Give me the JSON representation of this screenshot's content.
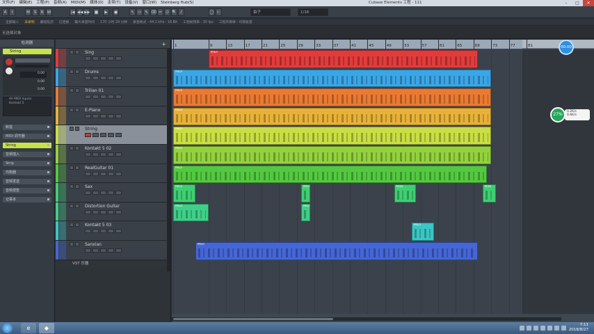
{
  "menu": [
    "文件(F)",
    "编辑(E)",
    "工程(P)",
    "音频(A)",
    "MIDI(M)",
    "媒体(D)",
    "走带(T)",
    "设备(V)",
    "窗口(W)",
    "Steinberg Hub(S)"
  ],
  "window_title": "Cubase Elements 工程 - 111",
  "window_buttons": [
    "–",
    "□",
    "✕"
  ],
  "toolbar": {
    "buttons": [
      "A",
      "I",
      "M",
      "S",
      "R",
      "W",
      "|◀",
      "◀◀",
      "▶▶",
      "■",
      "▶",
      "●",
      "↖",
      "▭",
      "✎",
      "⌫",
      "✂",
      "∅",
      "🔍",
      "♪",
      "◯",
      "⊢"
    ],
    "grid_label": "拍子",
    "quantize_value": "1/16"
  },
  "infoline": [
    {
      "text": "全部输入",
      "hl": false
    },
    {
      "text": "未录制",
      "hl": true
    },
    {
      "text": "最短延迟",
      "hl": false
    },
    {
      "text": "已连接",
      "hl": false
    },
    {
      "text": "最大录音时间",
      "hl": false
    },
    {
      "text": "170 小时 29 分钟",
      "hl": false
    },
    {
      "text": "录音格式 - 44.1 kHz - 16 Bit",
      "hl": false
    },
    {
      "text": "工程帧频率 - 30 fps",
      "hl": false
    },
    {
      "text": "工程声像律 - 均等能量",
      "hl": false
    }
  ],
  "selection_line": "无选择对象",
  "inspector": {
    "header": "检测器",
    "track_name": "String",
    "fader_values": [
      "0.00",
      "0.00",
      "0.00"
    ],
    "routing": [
      "All MIDI Inputs",
      "Kontakt 5"
    ],
    "sections": [
      "和弦",
      "MIDI 调节器",
      "String",
      "音频插入",
      "Strip",
      "均衡器",
      "音频发送",
      "音频便签",
      "记事本"
    ]
  },
  "tracks": [
    {
      "name": "Sing",
      "color": "#e23b3b"
    },
    {
      "name": "Drums",
      "color": "#3aa6e6"
    },
    {
      "name": "Trilian 01",
      "color": "#ea7a32"
    },
    {
      "name": "E-Piano",
      "color": "#e8b238"
    },
    {
      "name": "String",
      "color": "#c9de42"
    },
    {
      "name": "Kontakt 5 02",
      "color": "#93d23d"
    },
    {
      "name": "RealGuitar 01",
      "color": "#53c940"
    },
    {
      "name": "Sax",
      "color": "#3fcf73"
    },
    {
      "name": "Distortion Guitar",
      "color": "#3fcf88"
    },
    {
      "name": "Kontakt 5 03",
      "color": "#39c6c4"
    },
    {
      "name": "Sanxian",
      "color": "#4466d6"
    }
  ],
  "vst_label": "VST 乐器",
  "ruler_ticks": [
    "1",
    "9",
    "13",
    "17",
    "21",
    "25",
    "29",
    "33",
    "37",
    "41",
    "45",
    "49",
    "53",
    "57",
    "61",
    "65",
    "69",
    "73",
    "77",
    "81"
  ],
  "event_label": "MIDI",
  "events": [
    {
      "track": 0,
      "start": 9,
      "end": 70
    },
    {
      "track": 1,
      "start": 1,
      "end": 73
    },
    {
      "track": 2,
      "start": 1,
      "end": 73
    },
    {
      "track": 3,
      "start": 1,
      "end": 73
    },
    {
      "track": 4,
      "start": 1,
      "end": 73
    },
    {
      "track": 5,
      "start": 1,
      "end": 73
    },
    {
      "track": 6,
      "start": 1,
      "end": 72
    },
    {
      "track": 7,
      "start": 1,
      "end": 6
    },
    {
      "track": 7,
      "start": 30,
      "end": 32
    },
    {
      "track": 7,
      "start": 51,
      "end": 56
    },
    {
      "track": 7,
      "start": 71,
      "end": 74
    },
    {
      "track": 8,
      "start": 1,
      "end": 9
    },
    {
      "track": 8,
      "start": 30,
      "end": 32
    },
    {
      "track": 9,
      "start": 55,
      "end": 60
    },
    {
      "track": 10,
      "start": 6,
      "end": 70
    }
  ],
  "time_display": "00:00",
  "cpu": {
    "percent": "27%",
    "up": "0.2K/s",
    "down": "0.6K/s"
  },
  "clock": {
    "time": "7:11",
    "date": "2018/8/27"
  }
}
